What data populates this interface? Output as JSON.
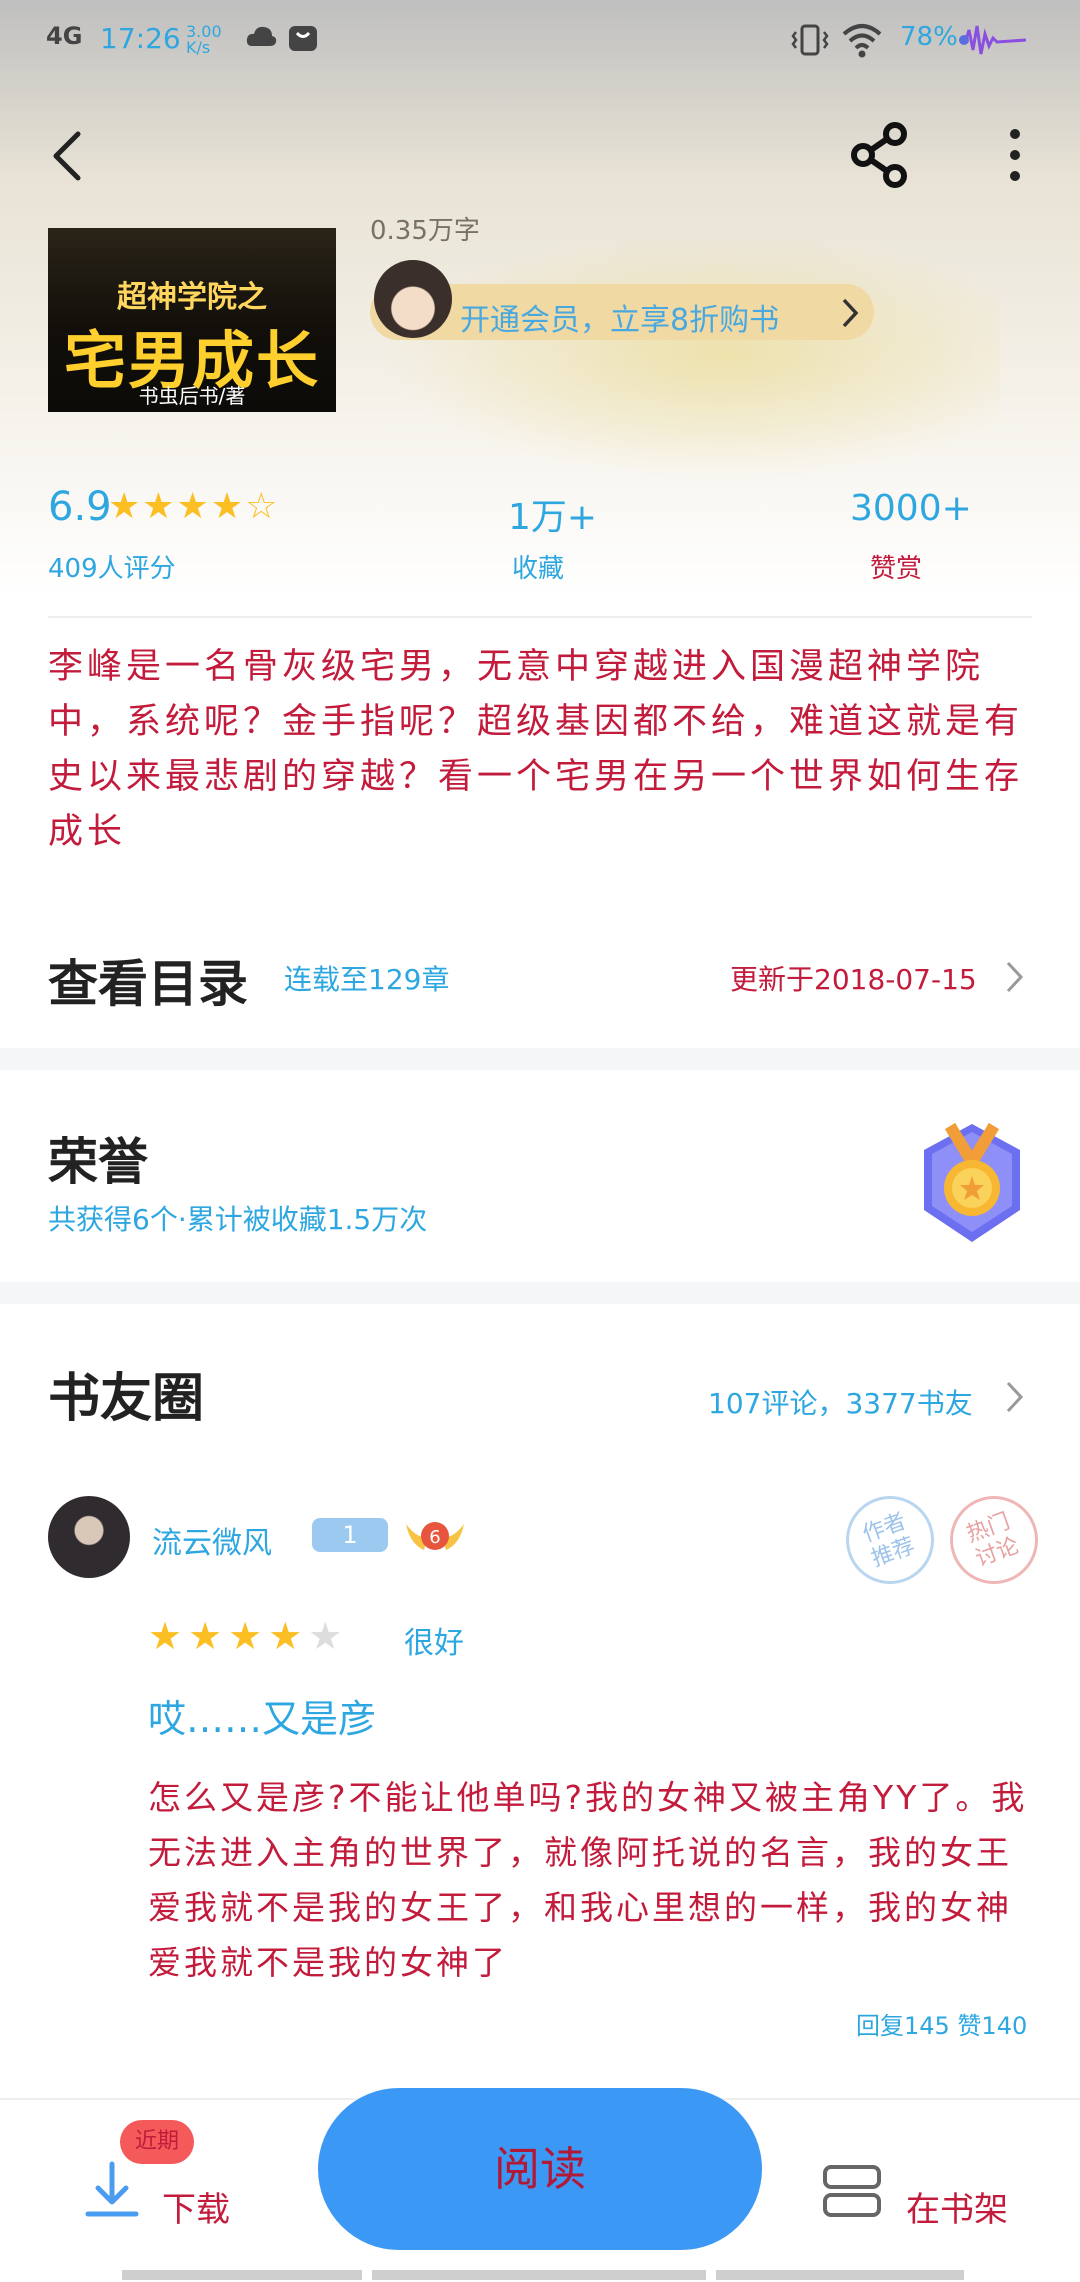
{
  "status_bar": {
    "network": "4G",
    "time": "17:26",
    "speed": "3.00 K/s",
    "battery": "78%"
  },
  "book": {
    "cover_line1": "超神学院之",
    "cover_line2": "宅男成长",
    "cover_author": "书虫后书/著",
    "word_count": "0.35万字",
    "vip_banner": "开通会员，立享8折购书"
  },
  "stats": {
    "rating": "6.9",
    "stars": "★★★★☆",
    "rating_label": "409人评分",
    "collect_value": "1万+",
    "collect_label": "收藏",
    "like_value": "3000+",
    "like_label": "赞赏"
  },
  "synopsis": "李峰是一名骨灰级宅男，无意中穿越进入国漫超神学院中，系统呢？金手指呢？超级基因都不给，难道这就是有史以来最悲剧的穿越？看一个宅男在另一个世界如何生存成长",
  "catalog": {
    "title": "查看目录",
    "serial": "连载至129章",
    "update": "更新于2018-07-15"
  },
  "honor": {
    "title": "荣誉",
    "desc": "共获得6个·累计被收藏1.5万次"
  },
  "circle": {
    "title": "书友圈",
    "stats": "107评论，3377书友"
  },
  "post": {
    "username": "流云微风",
    "level": "1",
    "fan_level": "6",
    "stamp1": "作者推荐",
    "stamp2": "热门讨论",
    "stars": "★★★★★",
    "rating_text": "很好",
    "title": "哎……又是彦",
    "body": "怎么又是彦?不能让他单吗?我的女神又被主角YY了。我无法进入主角的世界了，就像阿托说的名言，我的女王爱我就不是我的女王了，和我心里想的一样，我的女神爱我就不是我的女神了",
    "meta": "回复145 赞140"
  },
  "bottom": {
    "download_label": "下载",
    "recent_tag": "近期",
    "read_label": "阅读",
    "shelf_label": "在书架"
  },
  "colors": {
    "accent_blue": "#3c98f5",
    "text_red": "#c21b3b",
    "text_blue": "#2ea7e0",
    "star_gold": "#fbbf24"
  }
}
